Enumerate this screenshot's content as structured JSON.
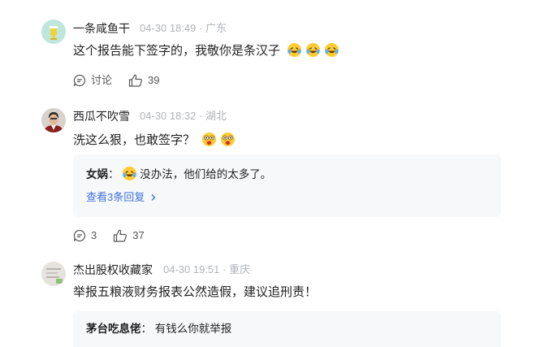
{
  "comments": [
    {
      "username": "一条咸鱼干",
      "date": "04-30 18:49",
      "location": "广东",
      "text": "这个报告能下签字的，我敬你是条汉子",
      "emojis": [
        "laugh-cry-emoji",
        "laugh-cry-emoji",
        "laugh-cry-emoji"
      ],
      "discuss_label": "讨论",
      "likes": "39"
    },
    {
      "username": "西瓜不吹雪",
      "date": "04-30 18:32",
      "location": "湖北",
      "text": "洗这么狠，也敢签字？",
      "emojis": [
        "shocked-emoji",
        "shocked-emoji"
      ],
      "reply": {
        "name": "女娲",
        "text": "没办法，他们给的太多了。",
        "more": "查看3条回复"
      },
      "replies": "3",
      "likes": "37"
    },
    {
      "username": "杰出股权收藏家",
      "date": "04-30 19:51",
      "location": "重庆",
      "text": "举报五粮液财务报表公然造假，建议追刑责！",
      "reply": {
        "name": "茅台吃息佬",
        "text": "有钱么你就举报"
      }
    }
  ],
  "colors": {
    "link": "#3d73d9",
    "meta": "#b0b3b8",
    "reply_bg": "#f7f8fa"
  }
}
